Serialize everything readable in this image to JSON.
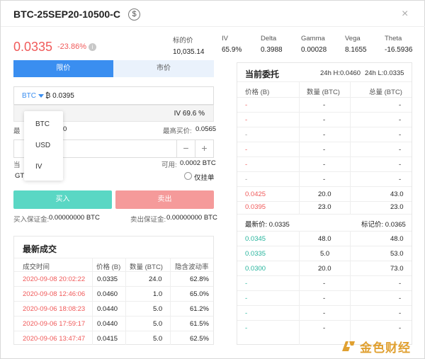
{
  "header": {
    "title": "BTC-25SEP20-10500-C",
    "dollar_icon": "$",
    "close_icon": "×"
  },
  "summary": {
    "last_price": "0.0335",
    "change": "-23.86%",
    "info_icon": "i"
  },
  "stats": [
    {
      "label": "标的价",
      "value": "10,035.14"
    },
    {
      "label": "IV",
      "value": "65.9%"
    },
    {
      "label": "Delta",
      "value": "0.3988"
    },
    {
      "label": "Gamma",
      "value": "0.00028"
    },
    {
      "label": "Vega",
      "value": "8.1655"
    },
    {
      "label": "Theta",
      "value": "-16.5936"
    }
  ],
  "order_form": {
    "tab_limit": "限价",
    "tab_market": "市价",
    "unit": "BTC",
    "price_value": "₿ 0.0395",
    "iv_value": "IV 69.6 %",
    "best_bid_label": "最",
    "best_bid_value": "0",
    "best_ask_label": "最高买价:",
    "best_ask_value": "0.0565",
    "minus": "−",
    "plus": "+",
    "position_label": "当",
    "available_label": "可用:",
    "available_value": "0.0002 BTC",
    "gtc_label": "GT",
    "post_only_label": "仅挂单",
    "buy_button": "买入",
    "sell_button": "卖出",
    "buy_margin_label": "买入保证金:",
    "buy_margin_value": "0.00000000 BTC",
    "sell_margin_label": "卖出保证金:",
    "sell_margin_value": "0.00000000 BTC"
  },
  "unit_dropdown": {
    "options": [
      "BTC",
      "USD",
      "IV"
    ]
  },
  "recent_trades": {
    "title": "最新成交",
    "columns": [
      "成交时间",
      "价格 (B)",
      "数量 (BTC)",
      "隐含波动率"
    ],
    "rows": [
      {
        "time": "2020-09-08 20:02:22",
        "price": "0.0335",
        "qty": "24.0",
        "iv": "62.8%"
      },
      {
        "time": "2020-09-08 12:46:06",
        "price": "0.0460",
        "qty": "1.0",
        "iv": "65.0%"
      },
      {
        "time": "2020-09-06 18:08:23",
        "price": "0.0440",
        "qty": "5.0",
        "iv": "61.2%"
      },
      {
        "time": "2020-09-06 17:59:17",
        "price": "0.0440",
        "qty": "5.0",
        "iv": "61.5%"
      },
      {
        "time": "2020-09-06 13:47:47",
        "price": "0.0415",
        "qty": "5.0",
        "iv": "62.5%"
      }
    ]
  },
  "order_book": {
    "title": "当前委托",
    "high": "24h H:0.0460",
    "low": "24h L:0.0335",
    "columns": [
      "价格 (B)",
      "数量 (BTC)",
      "总量 (BTC)"
    ],
    "asks": [
      [
        "-",
        "-",
        "-"
      ],
      [
        "-",
        "-",
        "-"
      ],
      [
        "-",
        "-",
        "-"
      ],
      [
        "-",
        "-",
        "-"
      ],
      [
        "-",
        "-",
        "-"
      ],
      [
        "-",
        "-",
        "-"
      ],
      [
        "0.0425",
        "20.0",
        "43.0"
      ],
      [
        "0.0395",
        "23.0",
        "23.0"
      ]
    ],
    "last_label": "最新价: 0.0335",
    "mark_label": "标记价: 0.0365",
    "bids": [
      [
        "0.0345",
        "48.0",
        "48.0"
      ],
      [
        "0.0335",
        "5.0",
        "53.0"
      ],
      [
        "0.0300",
        "20.0",
        "73.0"
      ],
      [
        "-",
        "-",
        "-"
      ],
      [
        "-",
        "-",
        "-"
      ],
      [
        "-",
        "-",
        "-"
      ],
      [
        "-",
        "-",
        "-"
      ]
    ]
  },
  "watermark": {
    "text": "金色财经"
  },
  "colors": {
    "accent": "#3a8ef0",
    "buy": "#5ad7c4",
    "sell": "#f59a9a",
    "down": "#f05a5a",
    "up": "#26b49c"
  }
}
